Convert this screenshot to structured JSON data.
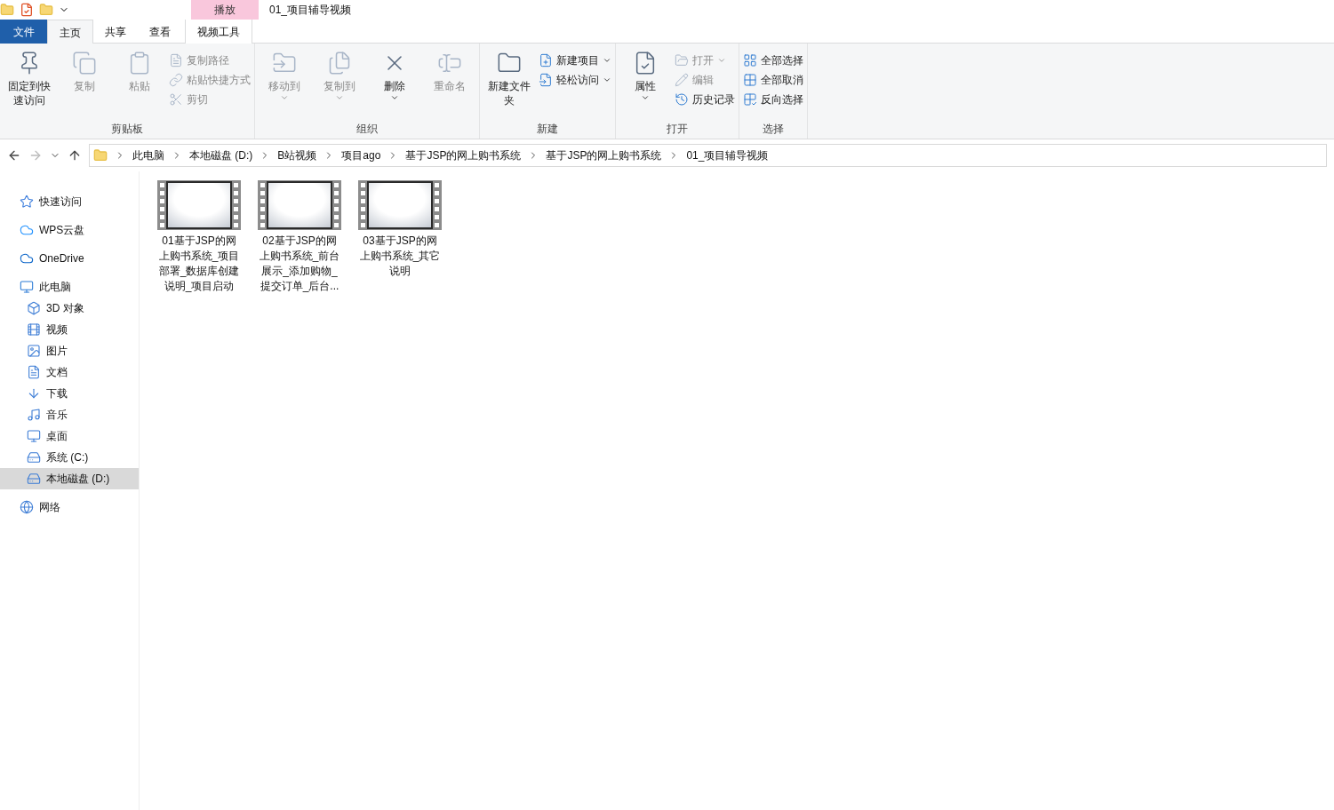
{
  "window": {
    "title": "01_项目辅导视频",
    "context_tab_header": "播放"
  },
  "tabs": [
    {
      "label": "文件",
      "kind": "file",
      "selected": false
    },
    {
      "label": "主页",
      "kind": "tab",
      "selected": true
    },
    {
      "label": "共享",
      "kind": "tab",
      "selected": false
    },
    {
      "label": "查看",
      "kind": "tab",
      "selected": false
    },
    {
      "label": "视频工具",
      "kind": "context",
      "selected": false
    }
  ],
  "ribbon": {
    "groups": [
      {
        "label": "剪贴板",
        "large": [
          {
            "label": "固定到快速访问",
            "disabled": false,
            "dropdown": false
          },
          {
            "label": "复制",
            "disabled": true,
            "dropdown": false
          },
          {
            "label": "粘贴",
            "disabled": true,
            "dropdown": false
          }
        ],
        "small": [
          {
            "label": "复制路径",
            "disabled": true,
            "dropdown": false
          },
          {
            "label": "粘贴快捷方式",
            "disabled": true,
            "dropdown": false
          },
          {
            "label": "剪切",
            "disabled": true,
            "dropdown": false
          }
        ]
      },
      {
        "label": "组织",
        "large": [
          {
            "label": "移动到",
            "disabled": true,
            "dropdown": true
          },
          {
            "label": "复制到",
            "disabled": true,
            "dropdown": true
          },
          {
            "label": "删除",
            "disabled": false,
            "dropdown": true
          },
          {
            "label": "重命名",
            "disabled": true,
            "dropdown": false
          }
        ]
      },
      {
        "label": "新建",
        "large": [
          {
            "label": "新建文件夹",
            "disabled": false,
            "dropdown": false
          }
        ],
        "small": [
          {
            "label": "新建项目",
            "disabled": false,
            "dropdown": true
          },
          {
            "label": "轻松访问",
            "disabled": false,
            "dropdown": true
          }
        ]
      },
      {
        "label": "打开",
        "large": [
          {
            "label": "属性",
            "disabled": false,
            "dropdown": true
          }
        ],
        "small": [
          {
            "label": "打开",
            "disabled": true,
            "dropdown": true
          },
          {
            "label": "编辑",
            "disabled": true,
            "dropdown": false
          },
          {
            "label": "历史记录",
            "disabled": false,
            "dropdown": false
          }
        ]
      },
      {
        "label": "选择",
        "small": [
          {
            "label": "全部选择",
            "disabled": false,
            "dropdown": false
          },
          {
            "label": "全部取消",
            "disabled": false,
            "dropdown": false
          },
          {
            "label": "反向选择",
            "disabled": false,
            "dropdown": false
          }
        ]
      }
    ]
  },
  "address": {
    "crumbs": [
      "此电脑",
      "本地磁盘 (D:)",
      "B站视频",
      "项目ago",
      "基于JSP的网上购书系统",
      "基于JSP的网上购书系统",
      "01_项目辅导视频"
    ]
  },
  "sidebar": {
    "items": [
      {
        "label": "快速访问",
        "selected": false
      },
      {
        "label": "WPS云盘",
        "selected": false
      },
      {
        "label": "OneDrive",
        "selected": false
      },
      {
        "label": "此电脑",
        "selected": false,
        "children": [
          {
            "label": "3D 对象",
            "selected": false
          },
          {
            "label": "视频",
            "selected": false
          },
          {
            "label": "图片",
            "selected": false
          },
          {
            "label": "文档",
            "selected": false
          },
          {
            "label": "下载",
            "selected": false
          },
          {
            "label": "音乐",
            "selected": false
          },
          {
            "label": "桌面",
            "selected": false
          },
          {
            "label": "系统 (C:)",
            "selected": false
          },
          {
            "label": "本地磁盘 (D:)",
            "selected": true
          }
        ]
      },
      {
        "label": "网络",
        "selected": false
      }
    ]
  },
  "files": [
    {
      "name": "01基于JSP的网上购书系统_项目部署_数据库创建说明_项目启动"
    },
    {
      "name": "02基于JSP的网上购书系统_前台展示_添加购物_提交订单_后台..."
    },
    {
      "name": "03基于JSP的网上购书系统_其它说明"
    }
  ]
}
